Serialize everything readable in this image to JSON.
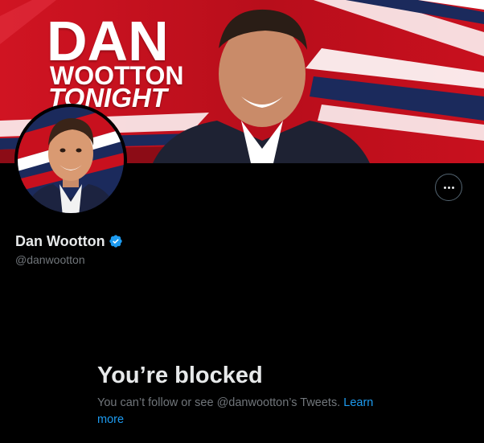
{
  "banner": {
    "line1": "DAN",
    "line2": "WOOTTON",
    "line3": "TONIGHT",
    "colors": {
      "red": "#c8101e",
      "dark_red": "#7a0a12",
      "navy": "#1b2a5c",
      "white": "#ffffff"
    }
  },
  "profile": {
    "display_name": "Dan Wootton",
    "handle": "@danwootton",
    "verified": true,
    "verified_color": "#1d9bf0"
  },
  "actions": {
    "more_icon": "more-horizontal-icon"
  },
  "blocked": {
    "title": "You’re blocked",
    "message": "You can’t follow or see @danwootton’s Tweets.",
    "link_label": "Learn more",
    "link_color": "#1d9bf0"
  }
}
